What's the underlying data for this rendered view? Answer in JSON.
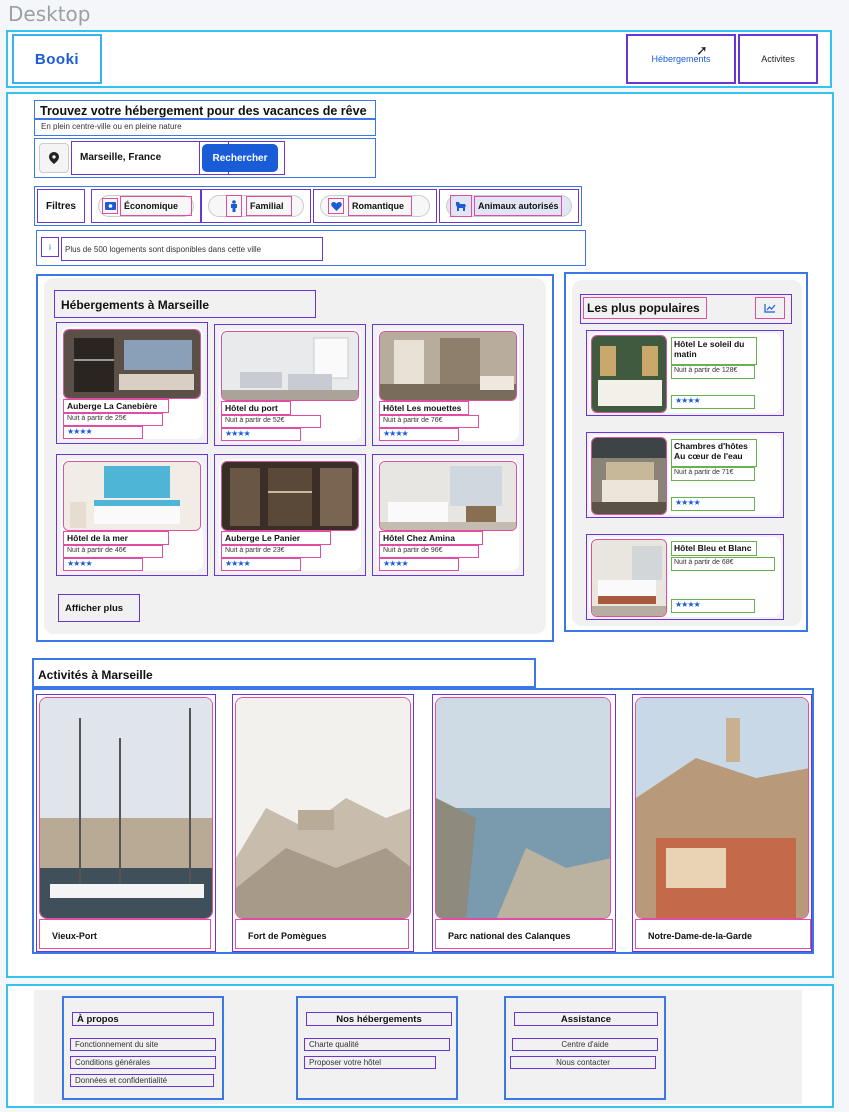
{
  "frame_label": "Desktop",
  "header": {
    "logo": "Booki",
    "nav": [
      "Hébergements",
      "Activites"
    ]
  },
  "hero": {
    "title": "Trouvez votre hébergement pour des vacances de rêve",
    "subtitle": "En plein centre-ville ou en pleine nature",
    "location_value": "Marseille, France",
    "search_label": "Rechercher"
  },
  "filters": {
    "label": "Filtres",
    "items": [
      "Économique",
      "Familial",
      "Romantique",
      "Animaux autorisés"
    ]
  },
  "info": {
    "icon": "i",
    "text": "Plus de 500 logements sont disponibles dans cette ville"
  },
  "hebergements": {
    "title": "Hébergements à Marseille",
    "more_label": "Afficher plus",
    "cards": [
      {
        "name": "Auberge La Canebière",
        "price": "Nuit à partir de 25€",
        "stars": "★★★★"
      },
      {
        "name": "Hôtel du port",
        "price": "Nuit à partir de 52€",
        "stars": "★★★★"
      },
      {
        "name": "Hôtel Les mouettes",
        "price": "Nuit à partir de 76€",
        "stars": "★★★★"
      },
      {
        "name": "Hôtel de la mer",
        "price": "Nuit à partir de 46€",
        "stars": "★★★★"
      },
      {
        "name": "Auberge Le Panier",
        "price": "Nuit à partir de 23€",
        "stars": "★★★★"
      },
      {
        "name": "Hôtel Chez Amina",
        "price": "Nuit à partir de 96€",
        "stars": "★★★★"
      }
    ]
  },
  "populaires": {
    "title": "Les plus populaires",
    "cards": [
      {
        "name": "Hôtel Le soleil du matin",
        "price": "Nuit à partir de 128€",
        "stars": "★★★★"
      },
      {
        "name": "Chambres d'hôtes Au cœur de l'eau",
        "price": "Nuit à partir de 71€",
        "stars": "★★★★"
      },
      {
        "name": "Hôtel Bleu et Blanc",
        "price": "Nuit à partir de 68€",
        "stars": "★★★★"
      }
    ]
  },
  "activites": {
    "title": "Activités à Marseille",
    "items": [
      "Vieux-Port",
      "Fort de Pomègues",
      "Parc national des Calanques",
      "Notre-Dame-de-la-Garde"
    ]
  },
  "footer": {
    "columns": [
      {
        "title": "À propos",
        "links": [
          "Fonctionnement du site",
          "Conditions générales",
          "Données et confidentialité"
        ]
      },
      {
        "title": "Nos hébergements",
        "links": [
          "Charte qualité",
          "Proposer votre hôtel"
        ]
      },
      {
        "title": "Assistance",
        "links": [
          "Centre d'aide",
          "Nous contacter"
        ]
      }
    ]
  }
}
